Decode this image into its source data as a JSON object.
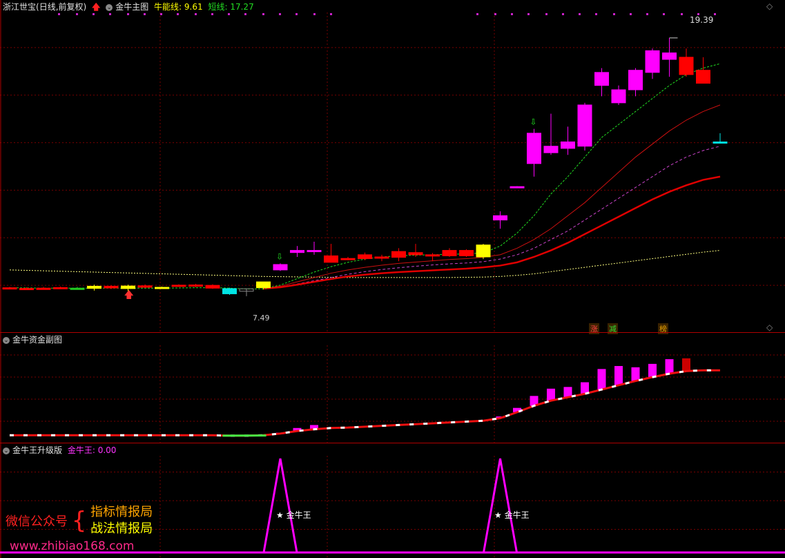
{
  "main": {
    "stock_name": "浙江世宝",
    "period": "(日线,前复权)",
    "indicator_name": "金牛主图",
    "niu_label": "牛能线:",
    "niu_value": "9.61",
    "short_label": "短线:",
    "short_value": "17.27",
    "high_label": "19.39",
    "low_label": "7.49",
    "tags": [
      "涨",
      "减",
      "榜"
    ]
  },
  "sub1": {
    "indicator_name": "金牛资金副图"
  },
  "sub2": {
    "indicator_name": "金牛王升级版",
    "value_label": "金牛王:",
    "value": "0.00",
    "signal_label": "★ 金牛王"
  },
  "promo": {
    "wechat": "微信公众号",
    "line1": "指标情报局",
    "line2": "战法情报局",
    "url": "www.zhibiao168.com"
  },
  "colors": {
    "up": "#ff0000",
    "down": "#00e5e5",
    "magenta": "#ff00ff",
    "yellow": "#ffff00",
    "grid": "#7a0000",
    "ma_red": "#e00000"
  },
  "chart_data": {
    "type": "candlestick",
    "price_range": [
      6.5,
      20.5
    ],
    "candles": [
      {
        "o": 7.88,
        "h": 7.92,
        "l": 7.81,
        "c": 7.85,
        "color": "red"
      },
      {
        "o": 7.85,
        "h": 7.9,
        "l": 7.8,
        "c": 7.83,
        "color": "red"
      },
      {
        "o": 7.86,
        "h": 7.92,
        "l": 7.8,
        "c": 7.84,
        "color": "red"
      },
      {
        "o": 7.87,
        "h": 7.93,
        "l": 7.82,
        "c": 7.89,
        "color": "red"
      },
      {
        "o": 7.86,
        "h": 7.92,
        "l": 7.8,
        "c": 7.85,
        "color": "green"
      },
      {
        "o": 7.95,
        "h": 8.02,
        "l": 7.75,
        "c": 7.85,
        "color": "yellow"
      },
      {
        "o": 7.95,
        "h": 7.99,
        "l": 7.82,
        "c": 7.87,
        "color": "red"
      },
      {
        "o": 7.96,
        "h": 8.02,
        "l": 7.72,
        "c": 7.84,
        "color": "yellow"
      },
      {
        "o": 7.97,
        "h": 8.03,
        "l": 7.87,
        "c": 7.9,
        "color": "red"
      },
      {
        "o": 7.9,
        "h": 7.93,
        "l": 7.82,
        "c": 7.84,
        "color": "yellow"
      },
      {
        "o": 8.0,
        "h": 8.04,
        "l": 7.92,
        "c": 7.95,
        "color": "red"
      },
      {
        "o": 8.01,
        "h": 8.06,
        "l": 7.9,
        "c": 7.98,
        "color": "red"
      },
      {
        "o": 7.99,
        "h": 8.04,
        "l": 7.83,
        "c": 7.86,
        "color": "red"
      },
      {
        "o": 7.84,
        "h": 7.88,
        "l": 7.55,
        "c": 7.6,
        "color": "cyan"
      },
      {
        "o": 7.83,
        "h": 7.85,
        "l": 7.49,
        "c": 7.72,
        "color": "none"
      },
      {
        "o": 7.88,
        "h": 8.15,
        "l": 7.8,
        "c": 8.15,
        "color": "yellow"
      },
      {
        "o": 8.7,
        "h": 9.0,
        "l": 8.65,
        "c": 8.95,
        "color": "magenta"
      },
      {
        "o": 9.5,
        "h": 9.8,
        "l": 9.3,
        "c": 9.6,
        "color": "magenta"
      },
      {
        "o": 9.55,
        "h": 10.0,
        "l": 9.4,
        "c": 9.6,
        "color": "magenta"
      },
      {
        "o": 9.35,
        "h": 9.9,
        "l": 9.1,
        "c": 9.05,
        "color": "red"
      },
      {
        "o": 9.23,
        "h": 9.3,
        "l": 9.15,
        "c": 9.2,
        "color": "red"
      },
      {
        "o": 9.4,
        "h": 9.5,
        "l": 9.15,
        "c": 9.22,
        "color": "red"
      },
      {
        "o": 9.28,
        "h": 9.4,
        "l": 9.1,
        "c": 9.3,
        "color": "red"
      },
      {
        "o": 9.55,
        "h": 9.7,
        "l": 9.1,
        "c": 9.28,
        "color": "red"
      },
      {
        "o": 9.5,
        "h": 9.9,
        "l": 9.3,
        "c": 9.4,
        "color": "red"
      },
      {
        "o": 9.4,
        "h": 9.48,
        "l": 9.1,
        "c": 9.36,
        "color": "red"
      },
      {
        "o": 9.6,
        "h": 9.7,
        "l": 9.3,
        "c": 9.35,
        "color": "red"
      },
      {
        "o": 9.6,
        "h": 9.65,
        "l": 9.3,
        "c": 9.35,
        "color": "red"
      },
      {
        "o": 9.85,
        "h": 9.9,
        "l": 9.2,
        "c": 9.3,
        "color": "yellow"
      },
      {
        "o": 11.0,
        "h": 11.4,
        "l": 10.6,
        "c": 11.2,
        "color": "magenta"
      },
      {
        "o": 12.5,
        "h": 12.56,
        "l": 12.5,
        "c": 12.54,
        "color": "magenta"
      },
      {
        "o": 13.6,
        "h": 15.2,
        "l": 13.0,
        "c": 15.0,
        "color": "magenta"
      },
      {
        "o": 14.1,
        "h": 15.9,
        "l": 14.0,
        "c": 14.4,
        "color": "magenta"
      },
      {
        "o": 14.3,
        "h": 15.3,
        "l": 14.0,
        "c": 14.6,
        "color": "magenta"
      },
      {
        "o": 14.4,
        "h": 16.4,
        "l": 14.2,
        "c": 16.3,
        "color": "magenta"
      },
      {
        "o": 17.2,
        "h": 18.0,
        "l": 16.7,
        "c": 17.8,
        "color": "magenta"
      },
      {
        "o": 16.4,
        "h": 17.2,
        "l": 16.3,
        "c": 17.0,
        "color": "magenta"
      },
      {
        "o": 17.0,
        "h": 18.0,
        "l": 16.7,
        "c": 17.9,
        "color": "magenta"
      },
      {
        "o": 17.8,
        "h": 18.9,
        "l": 17.5,
        "c": 18.8,
        "color": "magenta"
      },
      {
        "o": 18.7,
        "h": 19.39,
        "l": 17.6,
        "c": 18.4,
        "color": "magenta"
      },
      {
        "o": 18.5,
        "h": 18.9,
        "l": 17.6,
        "c": 17.7,
        "color": "red"
      },
      {
        "o": 17.9,
        "h": 18.5,
        "l": 17.4,
        "c": 17.3,
        "color": "red"
      },
      {
        "o": 14.6,
        "h": 15.0,
        "l": 14.6,
        "c": 14.6,
        "color": "cyan"
      }
    ],
    "ma_short": [
      7.88,
      7.87,
      7.86,
      7.86,
      7.86,
      7.86,
      7.86,
      7.86,
      7.86,
      7.86,
      7.87,
      7.88,
      7.88,
      7.86,
      7.82,
      7.83,
      8.0,
      8.3,
      8.6,
      8.85,
      9.05,
      9.2,
      9.3,
      9.35,
      9.38,
      9.4,
      9.42,
      9.44,
      9.48,
      9.8,
      10.4,
      11.2,
      12.2,
      13.0,
      13.9,
      14.8,
      15.4,
      16.0,
      16.6,
      17.2,
      17.7,
      18.0,
      18.2
    ],
    "ma_mid": [
      null,
      null,
      null,
      null,
      null,
      null,
      null,
      null,
      null,
      null,
      null,
      null,
      null,
      null,
      null,
      7.85,
      7.95,
      8.15,
      8.35,
      8.55,
      8.7,
      8.82,
      8.92,
      9.0,
      9.06,
      9.12,
      9.18,
      9.22,
      9.28,
      9.4,
      9.7,
      10.1,
      10.6,
      11.2,
      11.8,
      12.5,
      13.2,
      13.9,
      14.5,
      15.1,
      15.6,
      16.0,
      16.3
    ],
    "ma_purple": [
      null,
      null,
      null,
      null,
      null,
      null,
      null,
      null,
      null,
      null,
      null,
      null,
      null,
      null,
      null,
      7.84,
      7.92,
      8.05,
      8.2,
      8.35,
      8.5,
      8.62,
      8.72,
      8.8,
      8.87,
      8.93,
      8.98,
      9.02,
      9.08,
      9.2,
      9.4,
      9.7,
      10.1,
      10.5,
      11.0,
      11.5,
      12.0,
      12.5,
      13.0,
      13.5,
      13.9,
      14.2,
      14.4
    ],
    "ma_thick": [
      null,
      null,
      null,
      null,
      null,
      null,
      null,
      null,
      null,
      null,
      null,
      null,
      null,
      null,
      null,
      7.84,
      7.9,
      8.02,
      8.15,
      8.28,
      8.4,
      8.48,
      8.55,
      8.6,
      8.64,
      8.68,
      8.72,
      8.76,
      8.82,
      8.9,
      9.05,
      9.3,
      9.6,
      9.95,
      10.35,
      10.75,
      11.15,
      11.55,
      11.95,
      12.3,
      12.6,
      12.85,
      13.0
    ],
    "ma_long": [
      8.7,
      8.68,
      8.66,
      8.64,
      8.62,
      8.6,
      8.58,
      8.56,
      8.54,
      8.52,
      8.5,
      8.48,
      8.46,
      8.44,
      8.42,
      8.4,
      8.39,
      8.38,
      8.37,
      8.36,
      8.35,
      8.35,
      8.35,
      8.35,
      8.35,
      8.35,
      8.35,
      8.36,
      8.37,
      8.4,
      8.45,
      8.52,
      8.62,
      8.72,
      8.82,
      8.92,
      9.02,
      9.12,
      9.22,
      9.32,
      9.42,
      9.52,
      9.6
    ],
    "fund_line": [
      0.6,
      0.6,
      0.6,
      0.6,
      0.6,
      0.6,
      0.6,
      0.6,
      0.6,
      0.6,
      0.6,
      0.6,
      0.6,
      0.5,
      0.5,
      0.6,
      1.0,
      1.6,
      2.0,
      2.3,
      2.4,
      2.6,
      2.8,
      3.0,
      3.2,
      3.4,
      3.6,
      3.8,
      4.0,
      4.6,
      6.0,
      7.5,
      8.7,
      9.5,
      10.3,
      11.3,
      12.3,
      13.3,
      14.2,
      15.0,
      15.6,
      15.8,
      15.8
    ],
    "fund_bars": [
      null,
      null,
      null,
      null,
      null,
      null,
      null,
      null,
      null,
      null,
      null,
      null,
      null,
      null,
      null,
      null,
      1.2,
      2.3,
      3.0,
      null,
      null,
      null,
      null,
      null,
      null,
      null,
      null,
      null,
      null,
      5.0,
      7.0,
      9.8,
      11.5,
      11.9,
      13.0,
      16.1,
      16.8,
      16.5,
      17.3,
      18.4,
      18.6,
      null,
      null
    ],
    "fund_range": [
      0,
      21
    ],
    "signal_peaks_at": [
      16,
      29
    ],
    "signal_range": [
      0,
      1
    ]
  }
}
